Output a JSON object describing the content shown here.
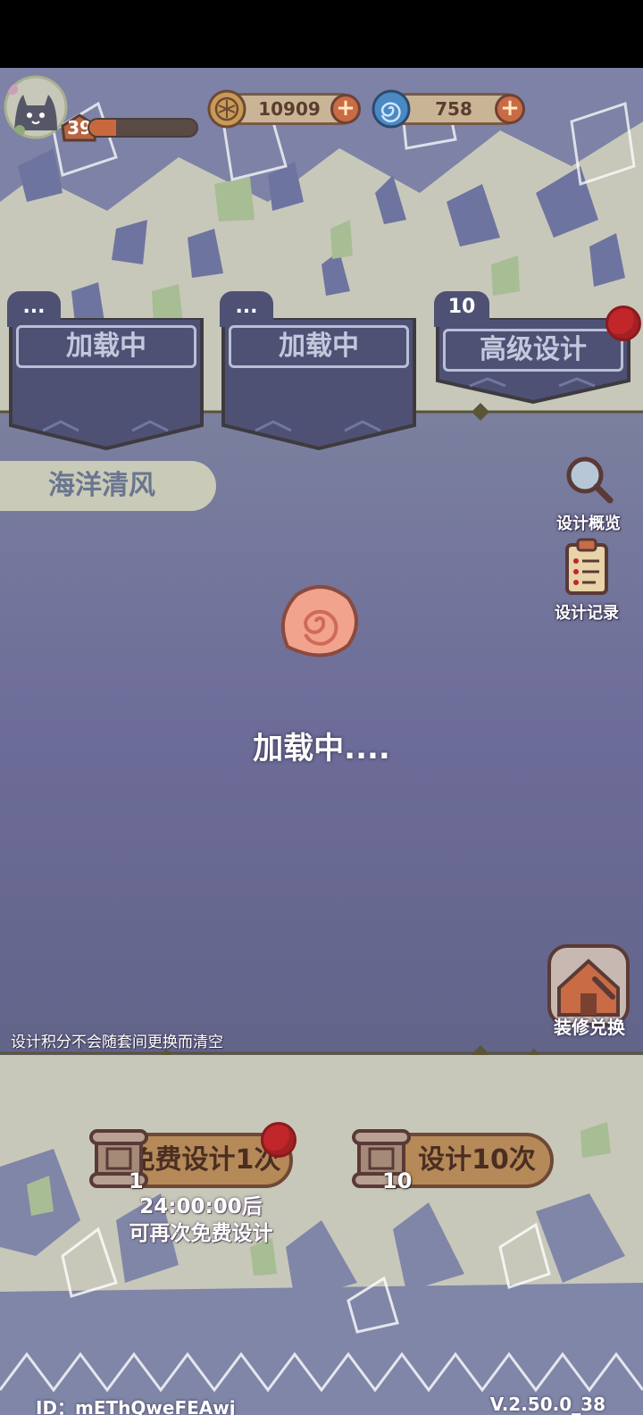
{
  "player": {
    "level": "39",
    "xp_fraction": 0.25
  },
  "currencies": [
    {
      "name": "coin",
      "amount": "10909",
      "icon": "coin-icon"
    },
    {
      "name": "gem",
      "amount": "758",
      "icon": "swirl-gem-icon"
    }
  ],
  "tabs": [
    {
      "tag": "...",
      "label": "加载中"
    },
    {
      "tag": "...",
      "label": "加载中"
    },
    {
      "tag": "10天",
      "label": "高级设计"
    }
  ],
  "theme_title": "海洋清风",
  "side": {
    "overview": "设计概览",
    "records": "设计记录",
    "decorate": "装修兑换"
  },
  "loading": "加载中....",
  "note": "设计积分不会随套间更换而清空",
  "draw": {
    "single_label": "免费设计1次",
    "single_count": "1",
    "ten_label": "设计10次",
    "ten_count": "10",
    "timer_line1": "24:00:00后",
    "timer_line2": "可再次免费设计"
  },
  "footer": {
    "id": "ID：mEThQweFEAwj",
    "version": "V.2.50.0_38"
  },
  "colors": {
    "accent": "#c96b44",
    "panel": "#4e5174",
    "badge": "#c0262a"
  }
}
